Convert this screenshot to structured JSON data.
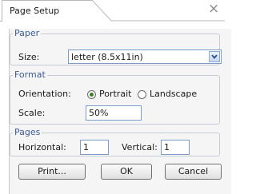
{
  "dialog": {
    "tab_title": "Page Setup"
  },
  "paper": {
    "legend": "Paper",
    "size_label": "Size:",
    "size_value": "letter (8.5x11in)"
  },
  "format": {
    "legend": "Format",
    "orientation_label": "Orientation:",
    "portrait_label": "Portrait",
    "landscape_label": "Landscape",
    "orientation_selected": "Portrait",
    "scale_label": "Scale:",
    "scale_value": "50%"
  },
  "pages": {
    "legend": "Pages",
    "horizontal_label": "Horizontal:",
    "horizontal_value": "1",
    "vertical_label": "Vertical:",
    "vertical_value": "1"
  },
  "buttons": {
    "print_label": "Print...",
    "ok_label": "OK",
    "cancel_label": "Cancel"
  },
  "icons": {
    "close": "close-icon",
    "dropdown": "chevron-down-icon"
  },
  "colors": {
    "legend_text": "#3a5a9a",
    "radio_selected": "#3f7a2a",
    "input_border": "#7a9cc6"
  }
}
